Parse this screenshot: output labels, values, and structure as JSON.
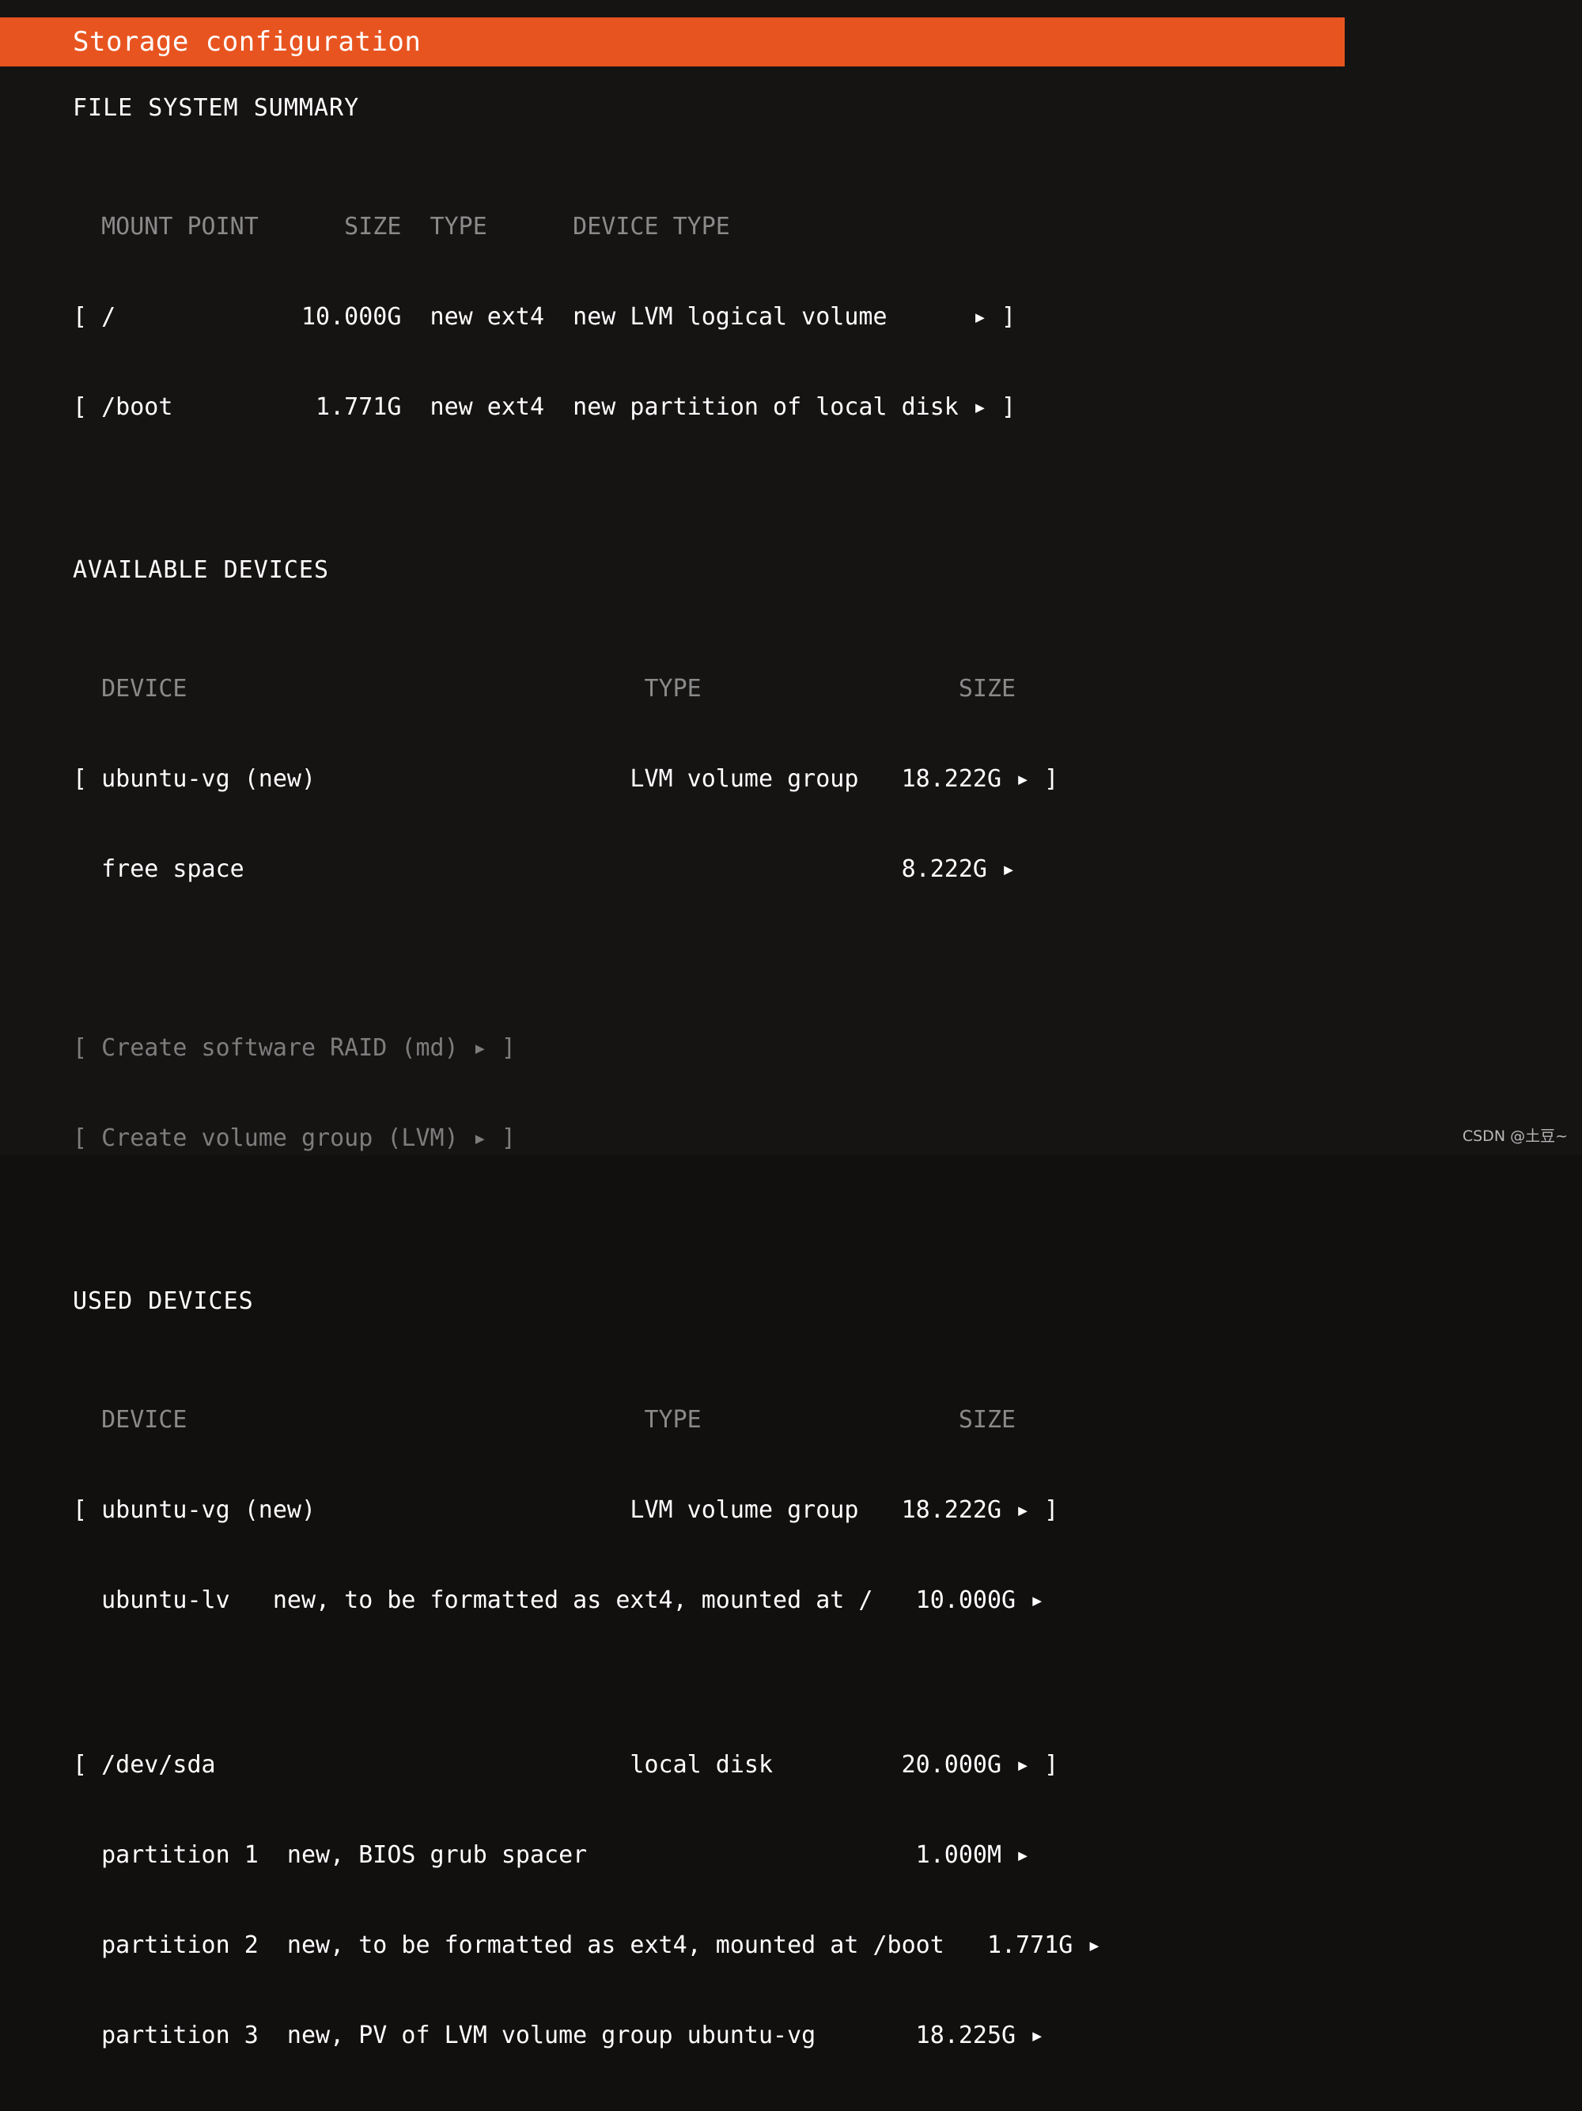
{
  "header": {
    "title": "Storage configuration",
    "accent_color": "#e85420",
    "background_color": "#161313",
    "text_color": "#ffffff",
    "dim_text_color": "#7d7d7d"
  },
  "filesystem_summary": {
    "section_title": "FILE SYSTEM SUMMARY",
    "columns": [
      "MOUNT POINT",
      "SIZE",
      "TYPE",
      "DEVICE TYPE"
    ],
    "rows": [
      {
        "open_bracket": "[",
        "mount_point": "/",
        "size": "10.000G",
        "type": "new ext4",
        "device_type": "new LVM logical volume",
        "arrow": "▸",
        "close_bracket": "]"
      },
      {
        "open_bracket": "[",
        "mount_point": "/boot",
        "size": "1.771G",
        "type": "new ext4",
        "device_type": "new partition of local disk",
        "arrow": "▸",
        "close_bracket": "]"
      }
    ]
  },
  "available_devices": {
    "section_title": "AVAILABLE DEVICES",
    "columns": [
      "DEVICE",
      "TYPE",
      "SIZE"
    ],
    "rows": [
      {
        "open_bracket": "[",
        "device": "ubuntu-vg (new)",
        "type": "LVM volume group",
        "size": "18.222G",
        "arrow": "▸",
        "close_bracket": "]",
        "selectable": true
      },
      {
        "open_bracket": " ",
        "device": "free space",
        "type": "",
        "size": "8.222G",
        "arrow": "▸",
        "close_bracket": " ",
        "selectable": false
      }
    ],
    "actions": [
      {
        "open_bracket": "[",
        "label": "Create software RAID (md)",
        "arrow": "▸",
        "close_bracket": "]",
        "enabled": false
      },
      {
        "open_bracket": "[",
        "label": "Create volume group (LVM)",
        "arrow": "▸",
        "close_bracket": "]",
        "enabled": false
      }
    ]
  },
  "used_devices": {
    "section_title": "USED DEVICES",
    "columns": [
      "DEVICE",
      "TYPE",
      "SIZE"
    ],
    "groups": [
      {
        "header": {
          "open_bracket": "[",
          "device": "ubuntu-vg (new)",
          "type": "LVM volume group",
          "size": "18.222G",
          "arrow": "▸",
          "close_bracket": "]"
        },
        "children": [
          {
            "device": "ubuntu-lv",
            "description": "new, to be formatted as ext4, mounted at /",
            "size": "10.000G",
            "arrow": "▸"
          }
        ]
      },
      {
        "header": {
          "open_bracket": "[",
          "device": "/dev/sda",
          "type": "local disk",
          "size": "20.000G",
          "arrow": "▸",
          "close_bracket": "]"
        },
        "children": [
          {
            "device": "partition 1",
            "description": "new, BIOS grub spacer",
            "size": "1.000M",
            "arrow": "▸"
          },
          {
            "device": "partition 2",
            "description": "new, to be formatted as ext4, mounted at /boot",
            "size": "1.771G",
            "arrow": "▸"
          },
          {
            "device": "partition 3",
            "description": "new, PV of LVM volume group ubuntu-vg",
            "size": "18.225G",
            "arrow": "▸"
          }
        ]
      }
    ]
  },
  "watermark": {
    "text": "CSDN @土豆~"
  },
  "rendered_lines": {
    "fs_header": "  MOUNT POINT      SIZE  TYPE      DEVICE TYPE",
    "fs_row_1": "[ /             10.000G  new ext4  new LVM logical volume      ▸ ]",
    "fs_row_2": "[ /boot          1.771G  new ext4  new partition of local disk ▸ ]",
    "av_header": "  DEVICE                                TYPE                  SIZE",
    "av_row_1": "[ ubuntu-vg (new)                      LVM volume group   18.222G ▸ ]",
    "av_row_2": "  free space                                              8.222G ▸",
    "av_act_1": "[ Create software RAID (md) ▸ ]",
    "av_act_2": "[ Create volume group (LVM) ▸ ]",
    "ud_header": "  DEVICE                                TYPE                  SIZE",
    "ud_row_1": "[ ubuntu-vg (new)                      LVM volume group   18.222G ▸ ]",
    "ud_row_2": "  ubuntu-lv   new, to be formatted as ext4, mounted at /   10.000G ▸",
    "ud_row_3": "[ /dev/sda                             local disk         20.000G ▸ ]",
    "ud_row_4": "  partition 1  new, BIOS grub spacer                       1.000M ▸",
    "ud_row_5": "  partition 2  new, to be formatted as ext4, mounted at /boot   1.771G ▸",
    "ud_row_6": "  partition 3  new, PV of LVM volume group ubuntu-vg       18.225G ▸"
  }
}
